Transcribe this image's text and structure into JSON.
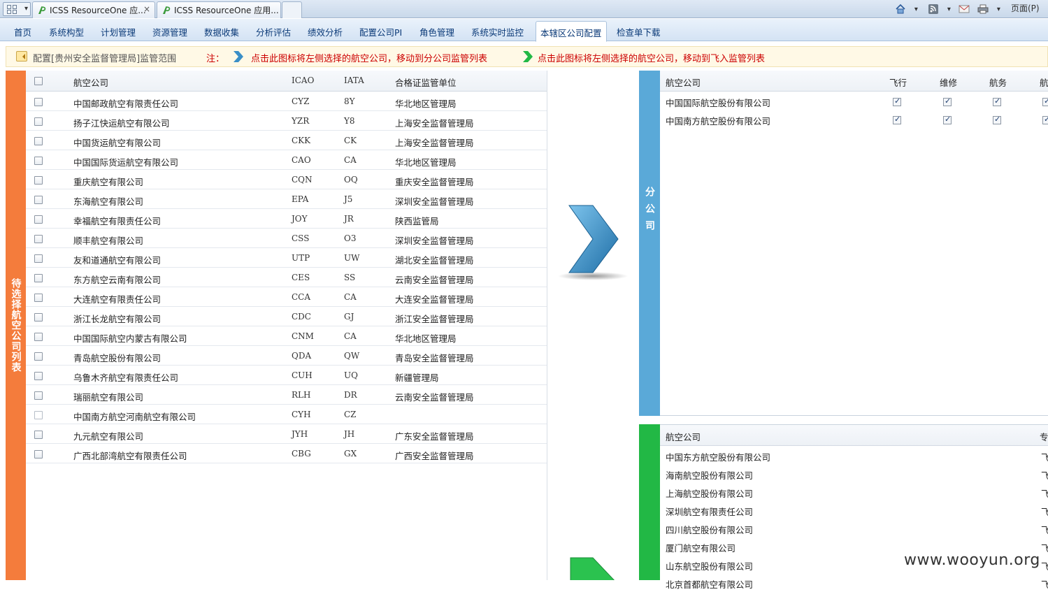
{
  "browser": {
    "tabs": [
      {
        "title": "ICSS ResourceOne 应..."
      },
      {
        "title": "ICSS ResourceOne 应用..."
      }
    ],
    "close_glyph": "×",
    "page_menu": "页面(P)"
  },
  "nav": {
    "items": [
      "首页",
      "系统构型",
      "计划管理",
      "资源管理",
      "数据收集",
      "分析评估",
      "绩效分析",
      "配置公司PI",
      "角色管理",
      "系统实时监控",
      "本辖区公司配置",
      "检查单下载"
    ],
    "active": "本辖区公司配置"
  },
  "notice": {
    "title": "配置[贵州安全监督管理局]监管范围",
    "label": "注：",
    "tip_branch": "点击此图标将左侧选择的航空公司，移动到分公司监管列表",
    "tip_flyin": "点击此图标将左侧选择的航空公司，移动到飞入监管列表",
    "branch_arrow_color": "#3a8fc7",
    "flyin_arrow_color": "#22b845"
  },
  "left": {
    "band_label": "待选择航空公司列表",
    "band_color": "#f47c3c",
    "headers": {
      "name": "航空公司",
      "icao": "ICAO",
      "iata": "IATA",
      "unit": "合格证监管单位"
    },
    "rows": [
      {
        "name": "中国邮政航空有限责任公司",
        "icao": "CYZ",
        "iata": "8Y",
        "unit": "华北地区管理局"
      },
      {
        "name": "扬子江快运航空有限公司",
        "icao": "YZR",
        "iata": "Y8",
        "unit": "上海安全监督管理局"
      },
      {
        "name": "中国货运航空有限公司",
        "icao": "CKK",
        "iata": "CK",
        "unit": "上海安全监督管理局"
      },
      {
        "name": "中国国际货运航空有限公司",
        "icao": "CAO",
        "iata": "CA",
        "unit": "华北地区管理局"
      },
      {
        "name": "重庆航空有限公司",
        "icao": "CQN",
        "iata": "OQ",
        "unit": "重庆安全监督管理局"
      },
      {
        "name": "东海航空有限公司",
        "icao": "EPA",
        "iata": "J5",
        "unit": "深圳安全监督管理局"
      },
      {
        "name": "幸福航空有限责任公司",
        "icao": "JOY",
        "iata": "JR",
        "unit": "陕西监管局"
      },
      {
        "name": "顺丰航空有限公司",
        "icao": "CSS",
        "iata": "O3",
        "unit": "深圳安全监督管理局"
      },
      {
        "name": "友和道通航空有限公司",
        "icao": "UTP",
        "iata": "UW",
        "unit": "湖北安全监督管理局"
      },
      {
        "name": "东方航空云南有限公司",
        "icao": "CES",
        "iata": "SS",
        "unit": "云南安全监督管理局"
      },
      {
        "name": "大连航空有限责任公司",
        "icao": "CCA",
        "iata": "CA",
        "unit": "大连安全监督管理局"
      },
      {
        "name": "浙江长龙航空有限公司",
        "icao": "CDC",
        "iata": "GJ",
        "unit": "浙江安全监督管理局"
      },
      {
        "name": "中国国际航空内蒙古有限公司",
        "icao": "CNM",
        "iata": "CA",
        "unit": "华北地区管理局"
      },
      {
        "name": "青岛航空股份有限公司",
        "icao": "QDA",
        "iata": "QW",
        "unit": "青岛安全监督管理局"
      },
      {
        "name": "乌鲁木齐航空有限责任公司",
        "icao": "CUH",
        "iata": "UQ",
        "unit": "新疆管理局"
      },
      {
        "name": "瑞丽航空有限公司",
        "icao": "RLH",
        "iata": "DR",
        "unit": "云南安全监督管理局"
      },
      {
        "name": "中国南方航空河南航空有限公司",
        "icao": "CYH",
        "iata": "CZ",
        "unit": ""
      },
      {
        "name": "九元航空有限公司",
        "icao": "JYH",
        "iata": "JH",
        "unit": "广东安全监督管理局"
      },
      {
        "name": "广西北部湾航空有限责任公司",
        "icao": "CBG",
        "iata": "GX",
        "unit": "广西安全监督管理局"
      }
    ]
  },
  "branch": {
    "band_label": "分公司",
    "band_color": "#5aa9d8",
    "headers": {
      "name": "航空公司",
      "c1": "飞行",
      "c2": "维修",
      "c3": "航务",
      "c4": "航"
    },
    "rows": [
      {
        "name": "中国国际航空股份有限公司"
      },
      {
        "name": "中国南方航空股份有限公司"
      }
    ]
  },
  "flyin": {
    "band_color": "#22b845",
    "headers": {
      "name": "航空公司",
      "c1": "专"
    },
    "row_mark": "飞",
    "rows": [
      {
        "name": "中国东方航空股份有限公司"
      },
      {
        "name": "海南航空股份有限公司"
      },
      {
        "name": "上海航空股份有限公司"
      },
      {
        "name": "深圳航空有限责任公司"
      },
      {
        "name": "四川航空股份有限公司"
      },
      {
        "name": "厦门航空有限公司"
      },
      {
        "name": "山东航空股份有限公司"
      },
      {
        "name": "北京首都航空有限公司"
      }
    ]
  },
  "watermark": "www.wooyun.org"
}
